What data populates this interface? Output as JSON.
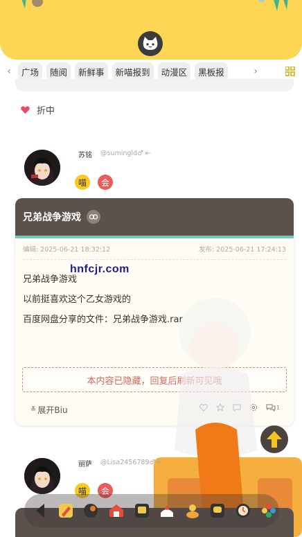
{
  "nav": {
    "tabs": [
      "广场",
      "随阅",
      "新鲜事",
      "新喵报到",
      "动漫区",
      "黑板报"
    ]
  },
  "like_row": {
    "label": "折中"
  },
  "post1": {
    "username": "苏铭",
    "handle": "@sumingld♂ ⇤",
    "badge1": "喵",
    "badge2": "会",
    "title": "兄弟战争游戏",
    "edited": "编辑: 2025-06-21 18:32:12",
    "published": "发布: 2025-06-21 17:24:13",
    "lines": [
      "兄弟战争游戏",
      "以前挺喜欢这个乙女游戏的",
      "百度网盘分享的文件：兄弟战争游戏.rar"
    ],
    "hidden_notice": "本内容已隐藏，回复后刷新可见哦",
    "expand": "展开Biu",
    "comment_count": "1"
  },
  "post2": {
    "username": "丽萨",
    "handle": "@Lisa2456789♂ ⇤",
    "badge1": "喵",
    "badge2": "会"
  },
  "watermark": "hnfcjr.com",
  "colors": {
    "header": "#fdd754",
    "card_header": "#5c524d",
    "accent_teal": "#6fc8b7",
    "badge_red": "#ee5a5a",
    "badge_yellow": "#f8c920"
  }
}
